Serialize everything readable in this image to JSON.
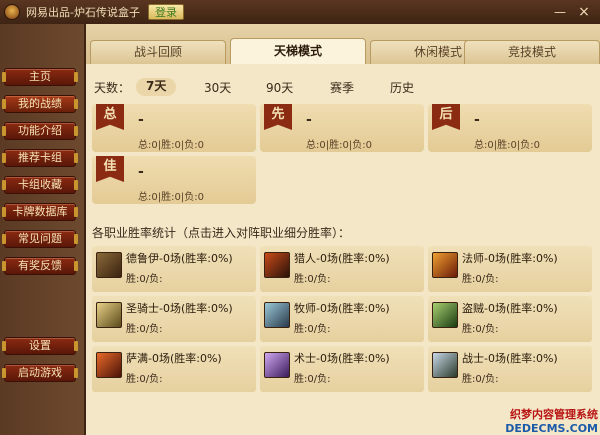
{
  "window": {
    "title": "网易出品-炉石传说盒子",
    "login_label": "登录",
    "minimize_glyph": "—",
    "close_glyph": "×"
  },
  "sidebar": {
    "items": [
      {
        "label": "主页",
        "active": false
      },
      {
        "label": "我的战绩",
        "active": true
      },
      {
        "label": "功能介绍",
        "active": false
      },
      {
        "label": "推荐卡组",
        "active": false
      },
      {
        "label": "卡组收藏",
        "active": false
      },
      {
        "label": "卡牌数据库",
        "active": false
      },
      {
        "label": "常见问题",
        "active": false
      },
      {
        "label": "有奖反馈",
        "active": false
      }
    ],
    "bottom": [
      {
        "label": "设置"
      },
      {
        "label": "启动游戏"
      }
    ]
  },
  "tabs": [
    {
      "label": "战斗回顾",
      "active": false
    },
    {
      "label": "天梯模式",
      "active": true
    },
    {
      "label": "休闲模式",
      "active": false
    },
    {
      "label": "竞技模式",
      "active": false
    }
  ],
  "days": {
    "label": "天数：",
    "options": [
      {
        "label": "7天",
        "active": true
      },
      {
        "label": "30天",
        "active": false
      },
      {
        "label": "90天",
        "active": false
      },
      {
        "label": "赛季",
        "active": false
      },
      {
        "label": "历史",
        "active": false
      }
    ]
  },
  "summary": [
    {
      "flag": "总",
      "value": "-",
      "stats": "总:0|胜:0|负:0"
    },
    {
      "flag": "先",
      "value": "-",
      "stats": "总:0|胜:0|负:0"
    },
    {
      "flag": "后",
      "value": "-",
      "stats": "总:0|胜:0|负:0"
    },
    {
      "flag": "佳",
      "value": "-",
      "stats": "总:0|胜:0|负:0"
    }
  ],
  "section_title": "各职业胜率统计（点击进入对阵职业细分胜率）：",
  "classes": [
    {
      "name": "德鲁伊-0场(胜率:0%)",
      "sub": "胜:0/负:",
      "icon": "druid-icon",
      "color": "#5a3a1a"
    },
    {
      "name": "猎人-0场(胜率:0%)",
      "sub": "胜:0/负:",
      "icon": "hunter-icon",
      "color": "#6a2a14"
    },
    {
      "name": "法师-0场(胜率:0%)",
      "sub": "胜:0/负:",
      "icon": "mage-icon",
      "color": "#b8401a"
    },
    {
      "name": "圣骑士-0场(胜率:0%)",
      "sub": "胜:0/负:",
      "icon": "paladin-icon",
      "color": "#8a7a3a"
    },
    {
      "name": "牧师-0场(胜率:0%)",
      "sub": "胜:0/负:",
      "icon": "priest-icon",
      "color": "#3a5a6a"
    },
    {
      "name": "盗贼-0场(胜率:0%)",
      "sub": "胜:0/负:",
      "icon": "rogue-icon",
      "color": "#3a5a2a"
    },
    {
      "name": "萨满-0场(胜率:0%)",
      "sub": "胜:0/负:",
      "icon": "shaman-icon",
      "color": "#7a2a1a"
    },
    {
      "name": "术士-0场(胜率:0%)",
      "sub": "胜:0/负:",
      "icon": "warlock-icon",
      "color": "#5a2a7a"
    },
    {
      "name": "战士-0场(胜率:0%)",
      "sub": "胜:0/负:",
      "icon": "warrior-icon",
      "color": "#4a5a3a"
    }
  ],
  "watermark": {
    "line1": "织梦内容管理系统",
    "line2": "DEDECMS.COM"
  }
}
